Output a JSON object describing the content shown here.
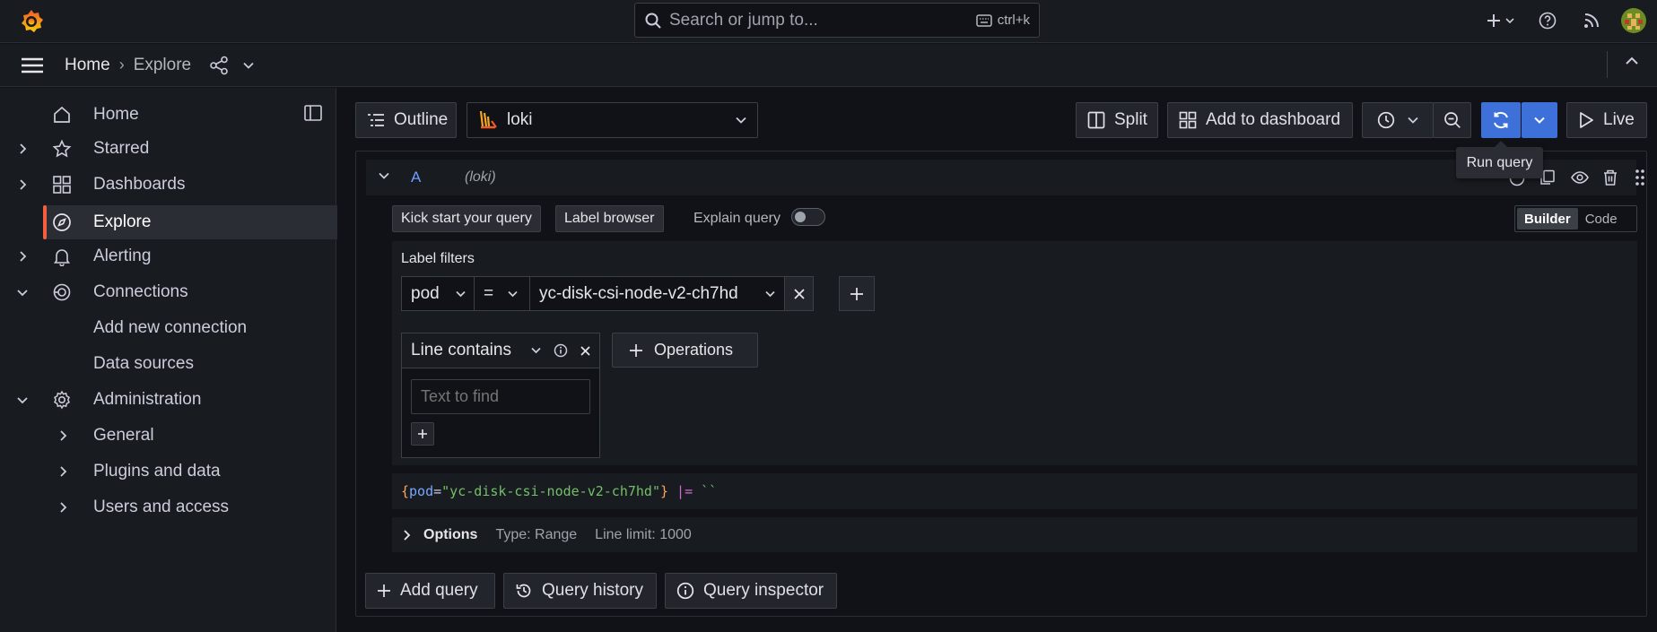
{
  "topbar": {
    "search_placeholder": "Search or jump to...",
    "shortcut": "ctrl+k"
  },
  "breadcrumb": {
    "home": "Home",
    "separator": "›",
    "current": "Explore"
  },
  "sidebar": {
    "items": [
      {
        "label": "Home",
        "icon": "home-icon"
      },
      {
        "label": "Starred",
        "icon": "star-icon"
      },
      {
        "label": "Dashboards",
        "icon": "apps-icon"
      },
      {
        "label": "Explore",
        "icon": "compass-icon",
        "active": true
      },
      {
        "label": "Alerting",
        "icon": "bell-icon"
      },
      {
        "label": "Connections",
        "icon": "connections-icon"
      },
      {
        "label": "Add new connection"
      },
      {
        "label": "Data sources"
      },
      {
        "label": "Administration",
        "icon": "cog-icon"
      },
      {
        "label": "General"
      },
      {
        "label": "Plugins and data"
      },
      {
        "label": "Users and access"
      }
    ]
  },
  "toolbar": {
    "outline": "Outline",
    "datasource": "loki",
    "split": "Split",
    "add_to_dashboard": "Add to dashboard",
    "live": "Live",
    "run_query_tooltip": "Run query"
  },
  "query": {
    "ref_id": "A",
    "datasource_hint": "(loki)",
    "kick_start": "Kick start your query",
    "label_browser": "Label browser",
    "explain_query": "Explain query",
    "mode_builder": "Builder",
    "mode_code": "Code",
    "label_filters_title": "Label filters",
    "filter": {
      "label": "pod",
      "operator": "=",
      "value": "yc-disk-csi-node-v2-ch7hd"
    },
    "operation": {
      "title": "Line contains",
      "placeholder": "Text to find"
    },
    "operations_button": "Operations",
    "preview": {
      "open_brace": "{",
      "key": "pod",
      "eq": "=",
      "value": "\"yc-disk-csi-node-v2-ch7hd\"",
      "close_brace": "}",
      "pipe": " |=",
      "literal": " ``"
    },
    "options": {
      "title": "Options",
      "type": "Type: Range",
      "line_limit": "Line limit: 1000"
    }
  },
  "footer_buttons": {
    "add_query": "Add query",
    "query_history": "Query history",
    "query_inspector": "Query inspector"
  },
  "colors": {
    "primary": "#3d71d9",
    "accent_orange": "#f55f3e",
    "background": "#111217",
    "panel": "#181b1f"
  }
}
